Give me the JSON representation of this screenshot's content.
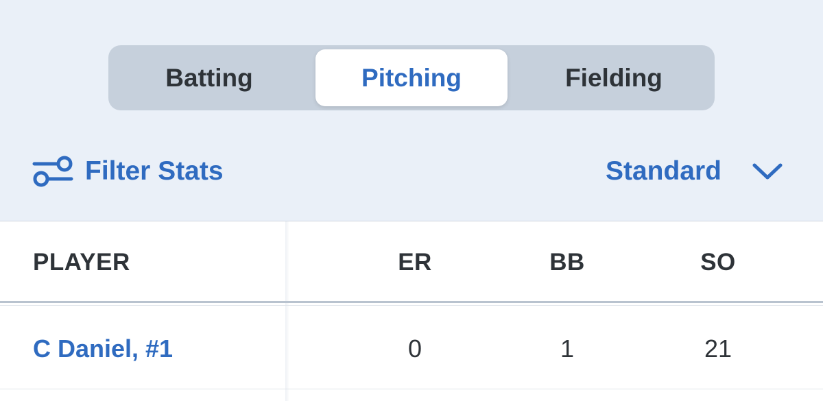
{
  "tabs": [
    {
      "label": "Batting",
      "selected": false
    },
    {
      "label": "Pitching",
      "selected": true
    },
    {
      "label": "Fielding",
      "selected": false
    }
  ],
  "filter": {
    "label": "Filter Stats",
    "icon": "filter-sliders-icon"
  },
  "view_select": {
    "selected": "Standard",
    "icon": "chevron-down-icon"
  },
  "table": {
    "columns": [
      "PLAYER",
      "ER",
      "BB",
      "SO"
    ],
    "rows": [
      {
        "player": "C Daniel, #1",
        "er": "0",
        "bb": "1",
        "so": "21"
      }
    ]
  },
  "colors": {
    "accent": "#2f6bc0",
    "background": "#eaf0f8",
    "segment_track": "#c6d0dc",
    "text": "#2e3338"
  }
}
